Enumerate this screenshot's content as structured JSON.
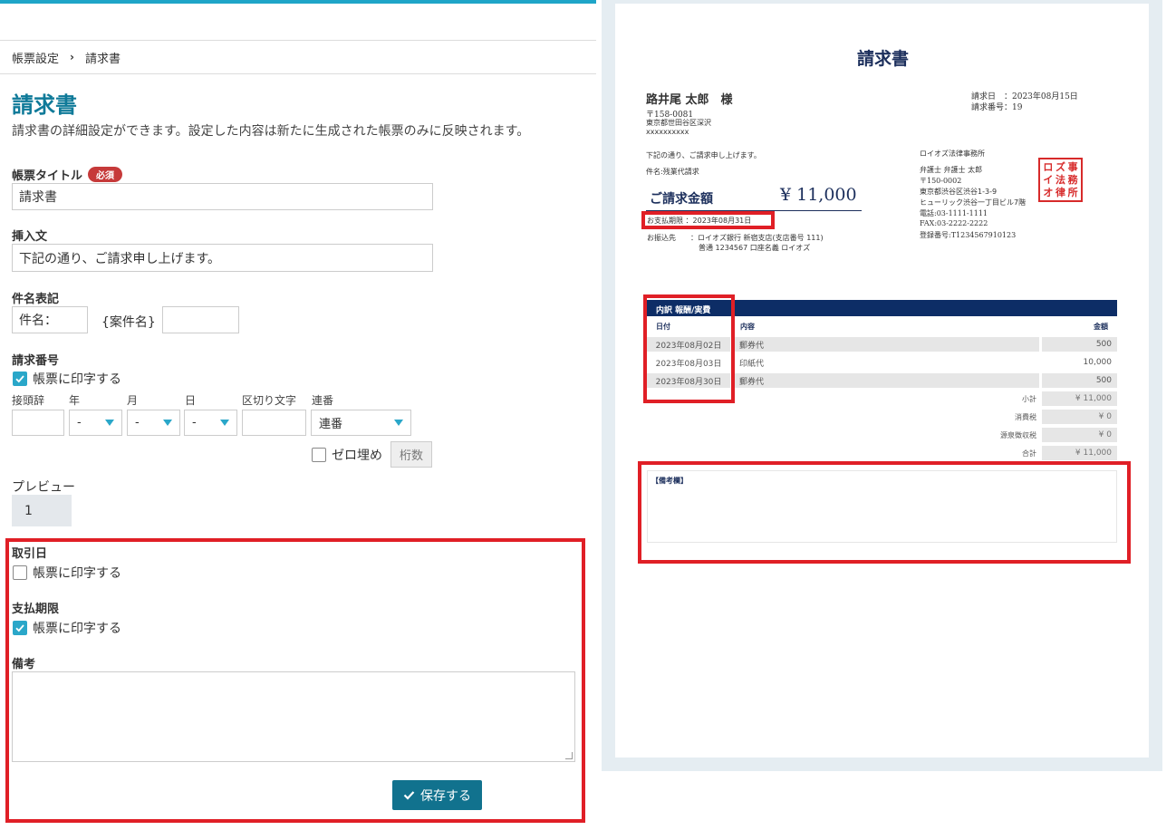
{
  "breadcrumb": {
    "parent": "帳票設定",
    "separator": "›",
    "current": "請求書"
  },
  "page": {
    "title": "請求書",
    "description": "請求書の詳細設定ができます。設定した内容は新たに生成された帳票のみに反映されます。"
  },
  "form": {
    "doc_title": {
      "label": "帳票タイトル",
      "required_badge": "必須",
      "value": "請求書"
    },
    "insert_text": {
      "label": "挿入文",
      "value": "下記の通り、ご請求申し上げます。"
    },
    "subject": {
      "label": "件名表記",
      "prefix_value": "件名：",
      "placeholder_token": "{案件名}",
      "suffix_value": ""
    },
    "invoice_number": {
      "label": "請求番号",
      "print_checkbox": {
        "label": "帳票に印字する",
        "checked": true
      },
      "fields": {
        "prefix": "接頭辞",
        "year": "年",
        "month": "月",
        "day": "日",
        "separator": "区切り文字",
        "serial": "連番"
      },
      "year_value": "-",
      "month_value": "-",
      "day_value": "-",
      "serial_value": "連番",
      "zero_pad": {
        "label": "ゼロ埋め",
        "checked": false
      },
      "digits_label": "桁数"
    },
    "preview": {
      "label": "プレビュー",
      "value": "1"
    },
    "trade_date": {
      "label": "取引日",
      "print_checkbox": {
        "label": "帳票に印字する",
        "checked": false
      }
    },
    "due_date": {
      "label": "支払期限",
      "print_checkbox": {
        "label": "帳票に印字する",
        "checked": true
      }
    },
    "memo": {
      "label": "備考",
      "value": ""
    },
    "save_label": "保存する"
  },
  "document": {
    "title": "請求書",
    "recipient": "路井尾 太郎　様",
    "recipient_zip": "〒158-0081",
    "recipient_address": "東京都世田谷区深沢",
    "recipient_address2": "xxxxxxxxxx",
    "date_line": "請求日　：2023年08月15日",
    "number_line": "請求番号：19",
    "greeting": "下記の通り、ご請求申し上げます。",
    "subject_line": "件名:残業代請求",
    "amount_label": "ご請求金額",
    "amount_value": "¥ 11,000",
    "due_line": "お支払期限 ：2023年08月31日",
    "bank_label": "お振込先",
    "bank_line1": "：ロイオズ銀行 新宿支店(支店番号 111)",
    "bank_line2": "普通 1234567  口座名義 ロイオズ",
    "firm": {
      "name": "ロイオズ法律事務所",
      "lines": [
        "弁護士 弁護士 太郎",
        "〒150-0002",
        "東京都渋谷区渋谷1-3-9",
        "ヒューリック渋谷一丁目ビル7階",
        "電話:03-1111-1111",
        "FAX:03-2222-2222",
        "登録番号:T1234567910123"
      ],
      "seal_chars": [
        "ロ",
        "イ",
        "オ",
        "ズ",
        "法",
        "律",
        "事",
        "務",
        "所"
      ]
    },
    "table": {
      "header": "内訳 報酬/実費",
      "columns": {
        "date": "日付",
        "content": "内容",
        "amount": "金額"
      },
      "rows": [
        {
          "date": "2023年08月02日",
          "content": "郵券代",
          "amount": "500"
        },
        {
          "date": "2023年08月03日",
          "content": "印紙代",
          "amount": "10,000"
        },
        {
          "date": "2023年08月30日",
          "content": "郵券代",
          "amount": "500"
        }
      ],
      "summary": [
        {
          "label": "小計",
          "value": "¥ 11,000"
        },
        {
          "label": "消費税",
          "value": "¥ 0"
        },
        {
          "label": "源泉徴収税",
          "value": "¥ 0"
        },
        {
          "label": "合計",
          "value": "¥ 11,000"
        }
      ]
    },
    "memo_label": "【備考欄】"
  },
  "colors": {
    "accent": "#0f7a99",
    "highlight": "#e01f26",
    "navy": "#0d2d66",
    "check": "#2aa7c9"
  }
}
